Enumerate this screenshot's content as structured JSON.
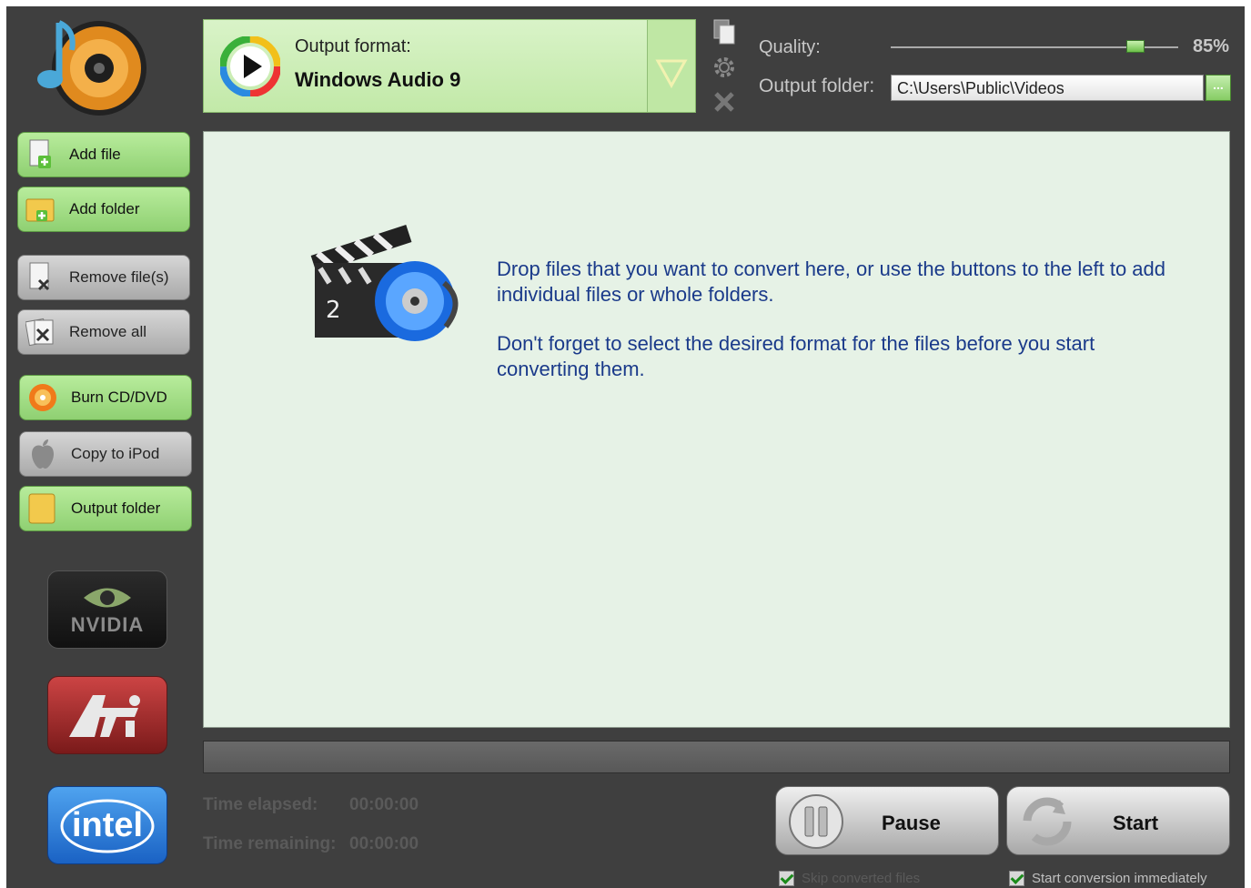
{
  "format": {
    "label": "Output format:",
    "value": "Windows Audio 9"
  },
  "quality": {
    "label": "Quality:",
    "value": "85%",
    "fraction": 0.85
  },
  "output_folder": {
    "label": "Output folder:",
    "path": "C:\\Users\\Public\\Videos",
    "browse": "..."
  },
  "sidebar": {
    "add_file": "Add file",
    "add_folder": "Add folder",
    "remove_files": "Remove file(s)",
    "remove_all": "Remove all",
    "burn": "Burn CD/DVD",
    "copy_ipod": "Copy to iPod",
    "output_folder": "Output folder"
  },
  "logos": {
    "nvidia": "NVIDIA",
    "intel": "intel"
  },
  "dropzone": {
    "line1": "Drop files that you want to convert here, or use the buttons to the left to add individual files or whole folders.",
    "line2": "Don't forget to select the desired format for the files before you start converting them."
  },
  "times": {
    "elapsed_label": "Time elapsed:",
    "elapsed": "00:00:00",
    "remaining_label": "Time remaining:",
    "remaining": "00:00:00"
  },
  "buttons": {
    "pause": "Pause",
    "start": "Start"
  },
  "options": {
    "skip": "Skip converted files",
    "immediate": "Start conversion immediately"
  },
  "colors": {
    "accent_green": "#9bd97e",
    "dropzone_bg": "#e6f2e6",
    "text_blue": "#1a3a8a",
    "app_bg": "#3f3f3f"
  }
}
